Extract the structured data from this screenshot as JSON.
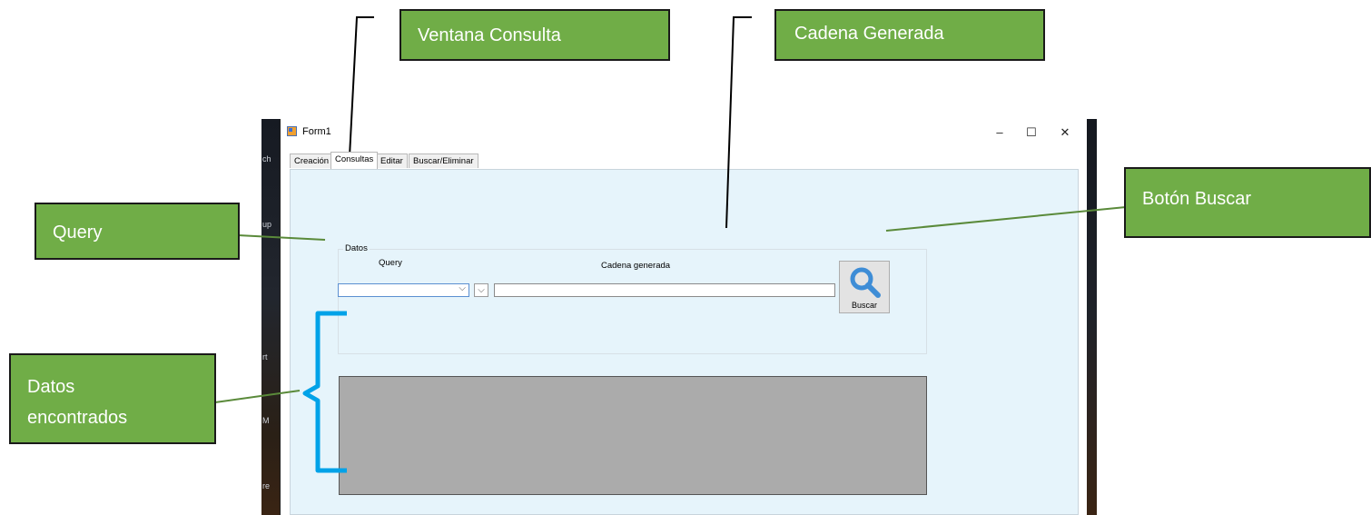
{
  "window": {
    "title": "Form1",
    "controls": {
      "minimize": "–",
      "maximize": "☐",
      "close": "✕"
    }
  },
  "desktop_edge_labels": [
    "ch",
    "up",
    "rt",
    "M",
    "re"
  ],
  "tabs": [
    {
      "label": "Creación",
      "active": false
    },
    {
      "label": "Consultas",
      "active": true
    },
    {
      "label": "Editar",
      "active": false
    },
    {
      "label": "Buscar/Eliminar",
      "active": false
    }
  ],
  "form": {
    "group_title": "Datos",
    "query_label": "Query",
    "cadena_label": "Cadena generada",
    "query_value": "",
    "operator_value": "",
    "cadena_value": "",
    "buscar_button_label": "Buscar",
    "buscar_icon": "magnifier-icon"
  },
  "annotations": {
    "ventana_consulta": "Ventana Consulta",
    "cadena_generada": "Cadena Generada",
    "query": "Query",
    "boton_buscar": "Botón Buscar",
    "datos_encontrados_line1": "Datos",
    "datos_encontrados_line2": "encontrados"
  },
  "colors": {
    "callout_fill": "#70ad47",
    "callout_connector": "#5a8a3a",
    "brace": "#00a2e8",
    "panel_background": "#e6f4fb",
    "grid_fill": "#ababab"
  }
}
